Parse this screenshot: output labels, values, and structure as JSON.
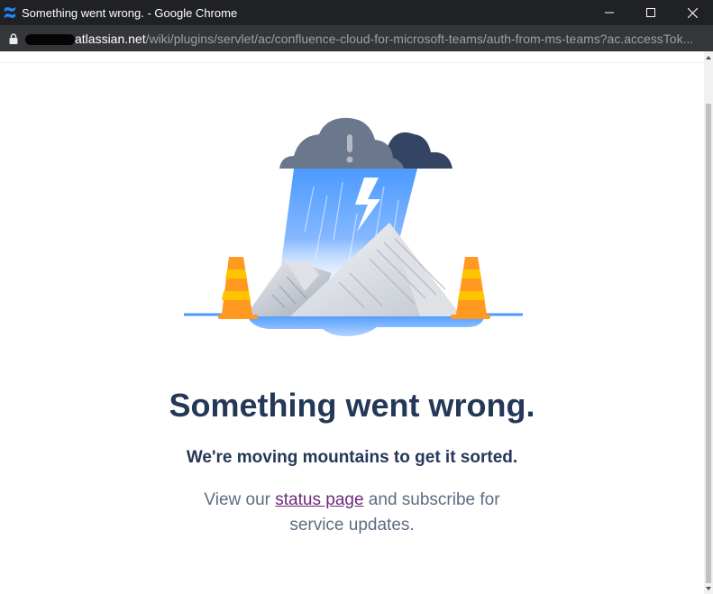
{
  "window": {
    "title": "Something went wrong. - Google Chrome",
    "app_icon": "confluence-icon"
  },
  "addressbar": {
    "host": "atlassian.net",
    "path": "/wiki/plugins/servlet/ac/confluence-cloud-for-microsoft-teams/auth-from-ms-teams?ac.accessTok..."
  },
  "page": {
    "headline": "Something went wrong.",
    "subtitle": "We're moving mountains to get it sorted.",
    "info_prefix": "View our ",
    "info_link": "status page",
    "info_suffix": " and subscribe for",
    "info_line2": "service updates."
  },
  "colors": {
    "heading": "#253858",
    "body_text": "#5e6c84",
    "link": "#6b2c7b",
    "titlebar": "#202124",
    "addressbar": "#35363a",
    "cone": "#ff991f"
  }
}
